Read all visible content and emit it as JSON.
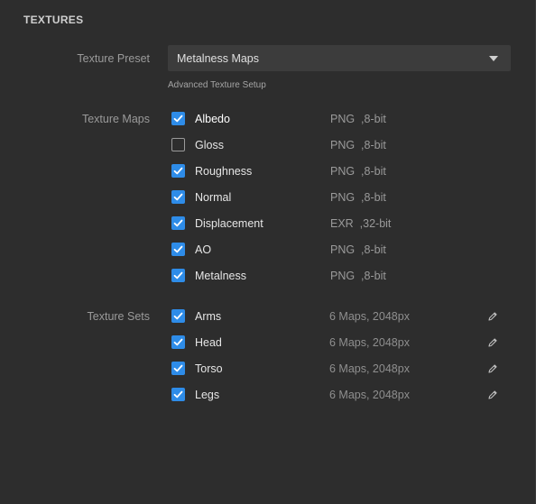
{
  "section": {
    "title": "TEXTURES"
  },
  "preset": {
    "label": "Texture Preset",
    "value": "Metalness Maps",
    "advanced_link": "Advanced Texture Setup"
  },
  "texture_maps": {
    "label": "Texture Maps",
    "items": [
      {
        "name": "Albedo",
        "checked": true,
        "format": "PNG",
        "depth": ",8-bit"
      },
      {
        "name": "Gloss",
        "checked": false,
        "format": "PNG",
        "depth": ",8-bit"
      },
      {
        "name": "Roughness",
        "checked": true,
        "format": "PNG",
        "depth": ",8-bit"
      },
      {
        "name": "Normal",
        "checked": true,
        "format": "PNG",
        "depth": ",8-bit"
      },
      {
        "name": "Displacement",
        "checked": true,
        "format": "EXR",
        "depth": ",32-bit"
      },
      {
        "name": "AO",
        "checked": true,
        "format": "PNG",
        "depth": ",8-bit"
      },
      {
        "name": "Metalness",
        "checked": true,
        "format": "PNG",
        "depth": ",8-bit"
      }
    ]
  },
  "texture_sets": {
    "label": "Texture Sets",
    "items": [
      {
        "name": "Arms",
        "checked": true,
        "info": "6 Maps, 2048px",
        "icon": "pencil-icon"
      },
      {
        "name": "Head",
        "checked": true,
        "info": "6 Maps, 2048px",
        "icon": "pencil-icon"
      },
      {
        "name": "Torso",
        "checked": true,
        "info": "6 Maps, 2048px",
        "icon": "pencil-icon"
      },
      {
        "name": "Legs",
        "checked": true,
        "info": "6 Maps, 2048px",
        "icon": "pencil-icon"
      }
    ]
  },
  "colors": {
    "accent": "#2e8ce8",
    "background": "#2d2d2d",
    "field": "#3c3c3c"
  }
}
